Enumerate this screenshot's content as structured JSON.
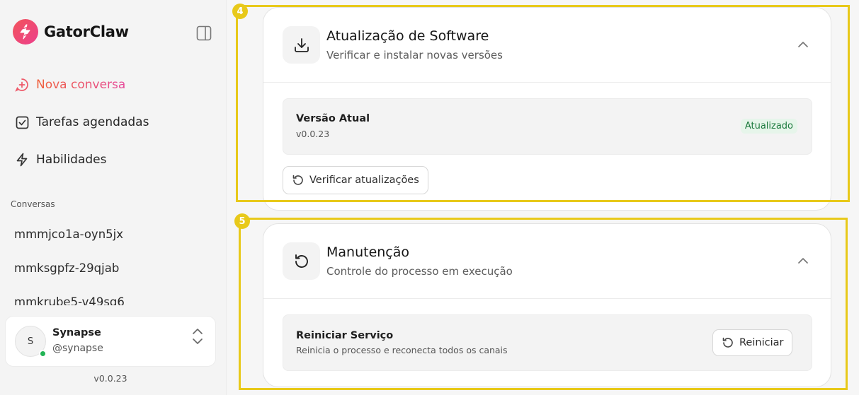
{
  "app": {
    "name": "GatorClaw",
    "version": "v0.0.23"
  },
  "sidebar": {
    "nav": [
      {
        "label": "Nova conversa",
        "icon": "chat-plus-icon"
      },
      {
        "label": "Tarefas agendadas",
        "icon": "checkbox-icon"
      },
      {
        "label": "Habilidades",
        "icon": "lightning-icon"
      }
    ],
    "section_label": "Conversas",
    "conversations": [
      "mmmjco1a-oyn5jx",
      "mmksgpfz-29qjab",
      "mmkrube5-v49sq6"
    ],
    "user": {
      "initial": "S",
      "name": "Synapse",
      "handle": "@synapse",
      "status": "online"
    }
  },
  "main": {
    "update_card": {
      "title": "Atualização de Software",
      "subtitle": "Verificar e instalar novas versões",
      "icon": "download-icon",
      "current_label": "Versão Atual",
      "current_value": "v0.0.23",
      "status_badge": "Atualizado",
      "check_button": "Verificar atualizações"
    },
    "maintenance_card": {
      "title": "Manutenção",
      "subtitle": "Controle do processo em execução",
      "icon": "restart-icon",
      "restart_title": "Reiniciar Serviço",
      "restart_desc": "Reinicia o processo e reconecta todos os canais",
      "restart_button": "Reiniciar"
    }
  },
  "annotations": [
    {
      "number": "4"
    },
    {
      "number": "5"
    }
  ],
  "colors": {
    "accent_start": "#f0603a",
    "accent_end": "#e64a9a",
    "highlight": "#e8c91a",
    "success": "#1c7a3d"
  }
}
